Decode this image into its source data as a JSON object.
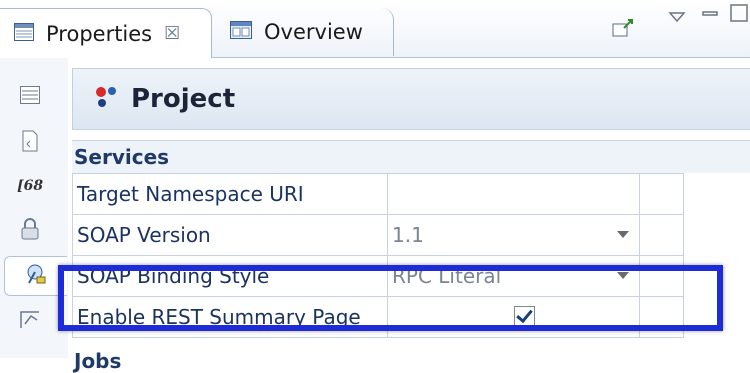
{
  "tabs": [
    {
      "label": "Properties",
      "close": "☒",
      "icon": "properties-icon"
    },
    {
      "label": "Overview",
      "icon": "overview-icon"
    }
  ],
  "toolbar": {
    "pin": "pin-icon",
    "menu": "view-menu-icon",
    "minimize": "minimize-icon",
    "maximize": "maximize-icon"
  },
  "side_tabs": [
    "general-icon",
    "document-icon",
    "binding-icon",
    "lock-icon",
    "services-icon",
    "jobs-icon"
  ],
  "header": {
    "title": "Project",
    "icon": "project-icon"
  },
  "section": "Services",
  "rows": [
    {
      "name": "Target Namespace URI",
      "value": "",
      "dropdown": false
    },
    {
      "name": "SOAP Version",
      "value": "1.1",
      "dropdown": true
    },
    {
      "name": "SOAP Binding Style",
      "value": "RPC Literal",
      "dropdown": true
    },
    {
      "name": "Enable REST Summary Page",
      "checked": true
    }
  ],
  "next_section": "Jobs",
  "accent_color": "#1d2bd8"
}
